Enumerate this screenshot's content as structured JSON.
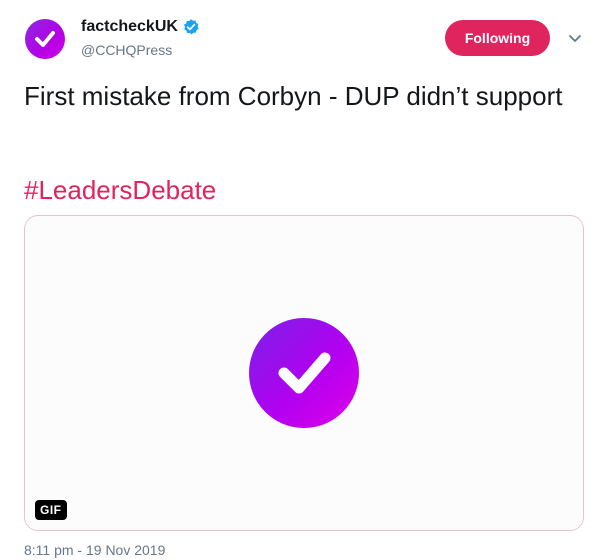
{
  "author": {
    "display_name": "factcheckUK",
    "handle": "@CCHQPress",
    "avatar_icon": "checkmark-logo-icon",
    "verified_icon": "verified-badge-icon",
    "verified_color": "#1da1f2"
  },
  "follow_button": {
    "label": "Following",
    "color": "#e0245e"
  },
  "menu": {
    "icon": "chevron-down-icon"
  },
  "tweet": {
    "text": "First mistake from Corbyn - DUP didn’t support",
    "hashtag": "#LeadersDebate",
    "hashtag_color": "#e0245e"
  },
  "media": {
    "badge": "GIF",
    "content_icon": "checkmark-logo-icon"
  },
  "timestamp": "8:11 pm - 19 Nov 2019"
}
